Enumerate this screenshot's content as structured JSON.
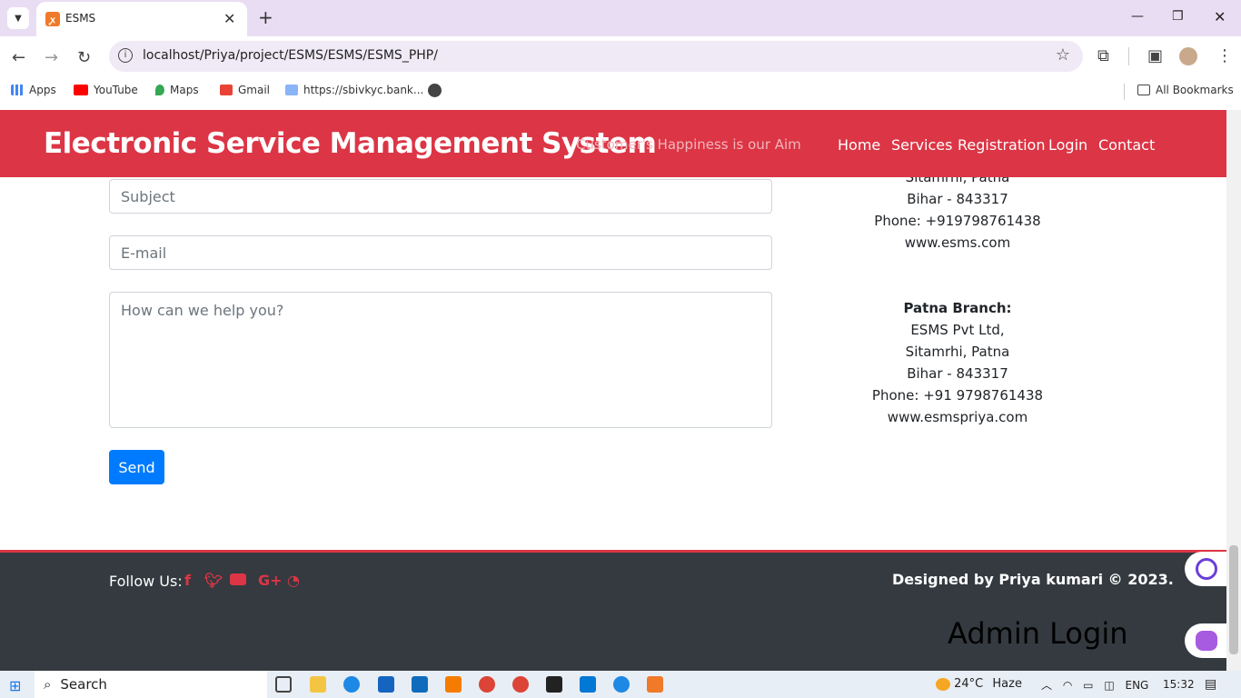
{
  "browser": {
    "tab_title": "ESMS",
    "url": "localhost/Priya/project/ESMS/ESMS/ESMS_PHP/",
    "bookmarks": [
      "Apps",
      "YouTube",
      "Maps",
      "Gmail",
      "https://sbivkyc.bank...",
      "All Bookmarks"
    ]
  },
  "site": {
    "brand": "Electronic Service Management System",
    "tagline": "Customer's Happiness is our Aim",
    "nav": [
      "Home",
      "Services",
      "Registration",
      "Login",
      "Contact"
    ]
  },
  "form": {
    "subject_placeholder": "Subject",
    "email_placeholder": "E-mail",
    "message_placeholder": "How can we help you?",
    "send_label": "Send"
  },
  "address_top": [
    "Sitamrhi, Patna",
    "Bihar - 843317",
    "Phone: +919798761438",
    "www.esms.com"
  ],
  "address_patna": {
    "heading": "Patna Branch:",
    "lines": [
      "ESMS Pvt Ltd,",
      "Sitamrhi, Patna",
      "Bihar - 843317",
      "Phone: +91 9798761438",
      "www.esmspriya.com"
    ]
  },
  "footer": {
    "follow_label": "Follow Us:",
    "social_icons": [
      "facebook-icon",
      "twitter-icon",
      "youtube-icon",
      "google-plus-icon",
      "rss-icon"
    ],
    "designed_by": "Designed by Priya kumari © 2023.",
    "admin_login": "Admin Login"
  },
  "taskbar": {
    "search_label": "Search",
    "weather_temp": "24°C",
    "weather_text": "Haze",
    "language": "ENG",
    "time": "15:32"
  },
  "colors": {
    "brand_red": "#dc3545",
    "send_blue": "#007bff",
    "footer_dark": "#343a40"
  }
}
